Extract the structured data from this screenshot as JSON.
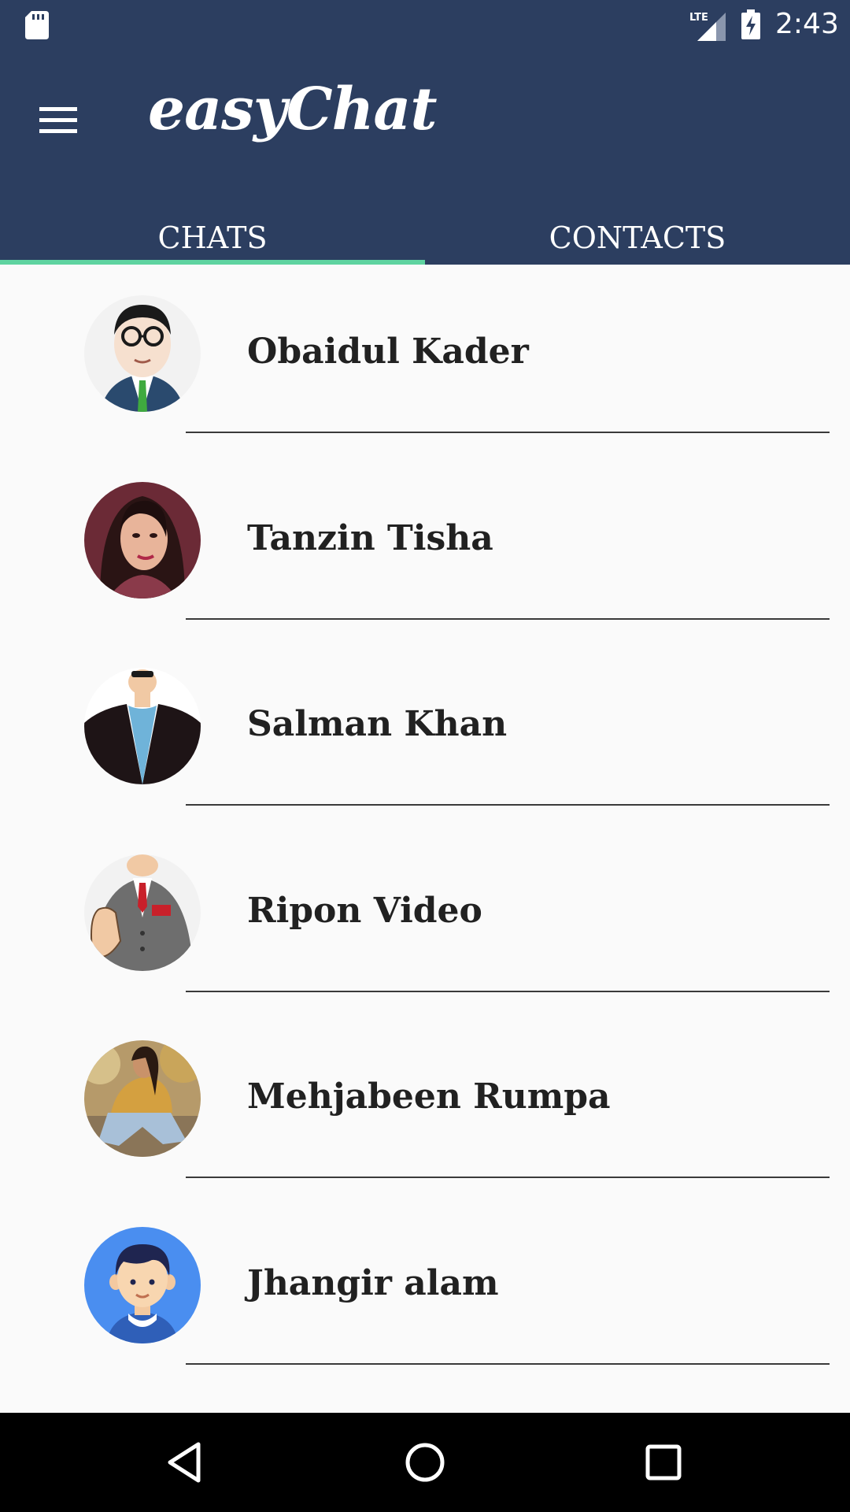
{
  "status_bar": {
    "time": "2:43",
    "icons": [
      "sd-card-icon",
      "lte-signal-icon",
      "battery-charging-icon"
    ],
    "background": "#2c3e60"
  },
  "app_bar": {
    "title": "easyChat",
    "menu_icon": "menu-icon",
    "background": "#2c3e60"
  },
  "tabs": [
    {
      "label": "CHATS",
      "selected": true
    },
    {
      "label": "CONTACTS",
      "selected": false
    }
  ],
  "tab_indicator_color": "#5ed3a0",
  "chats": [
    {
      "name": "Obaidul Kader",
      "avatar": "cartoon-man-glasses-avatar"
    },
    {
      "name": "Tanzin Tisha",
      "avatar": "woman-portrait-avatar"
    },
    {
      "name": "Salman Khan",
      "avatar": "cartoon-man-jacket-avatar"
    },
    {
      "name": "Ripon Video",
      "avatar": "cartoon-man-suit-hand-avatar"
    },
    {
      "name": "Mehjabeen Rumpa",
      "avatar": "woman-outdoor-photo-avatar"
    },
    {
      "name": "Jhangir alam",
      "avatar": "cartoon-boy-blue-avatar"
    }
  ],
  "nav_bar": {
    "buttons": [
      "back-icon",
      "home-icon",
      "recents-icon"
    ]
  }
}
